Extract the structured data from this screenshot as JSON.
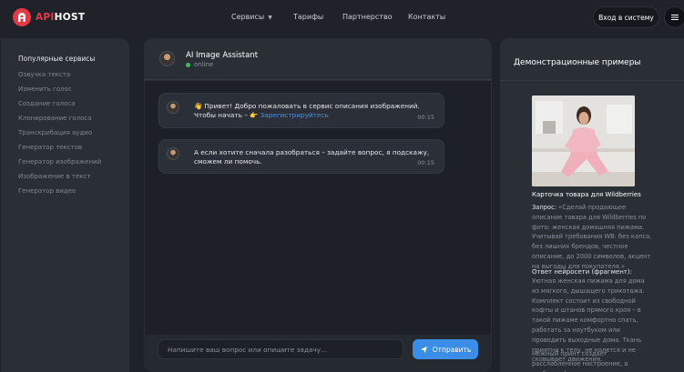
{
  "header": {
    "logo_prefix": "API",
    "logo_suffix": "HOST",
    "nav": [
      {
        "label": "Сервисы"
      },
      {
        "label": "Тарифы"
      },
      {
        "label": "Партнерство"
      },
      {
        "label": "Контакты"
      }
    ],
    "login_label": "Вход в систему"
  },
  "sidebar": {
    "title": "Популярные сервисы",
    "items": [
      {
        "label": "Озвучка текста"
      },
      {
        "label": "Изменить голос"
      },
      {
        "label": "Создание голоса"
      },
      {
        "label": "Клонирование голоса"
      },
      {
        "label": "Транскрибация аудио"
      },
      {
        "label": "Генератор текстов"
      },
      {
        "label": "Генератор изображений"
      },
      {
        "label": "Изображение в текст"
      },
      {
        "label": "Генератор видео"
      }
    ]
  },
  "chat": {
    "assistant_name": "AI Image Assistant",
    "status": "online",
    "messages": [
      {
        "line1": "👋 Привет! Добро пожаловать в сервис описания изображений.",
        "line2_prefix": "Чтобы начать – 👉 ",
        "link": "Зарегистрируйтесь",
        "time": "00:15"
      },
      {
        "line1": "А если хотите сначала разобраться – задайте вопрос, я подскажу,",
        "line2": "сможем ли помочь.",
        "time": "00:15"
      }
    ],
    "input_placeholder": "Напишите ваш вопрос или опишите задачу...",
    "send_label": "Отправить"
  },
  "demo": {
    "title": "Демонстрационные примеры",
    "caption": "Карточка товара для Wildberries",
    "request_label": "Запрос:",
    "request_text": "«Сделай продающее описание товара для Wildberries по фото: женская домашняя пижама. Учитывай требования WB: без капса, без лишних брендов, честное описание, до 2000 символов, акцент на выгоды для покупателя.»",
    "answer_label": "Ответ нейросети (фрагмент):",
    "answer_text": "Уютная женская пижама для дома из мягкого, дышащего трикотажа. Комплект состоит из свободной кофты и штанов прямого кроя – в такой пижаме комфортно спать, работать за ноутбуком или проводить выходные дома. Ткань приятна к телу, не колется и не сковывает движения.",
    "answer_text2": "Нежный принт создаёт расслабленное настроение, а свободный силуэт подходит"
  },
  "colors": {
    "accent": "#e53945",
    "primary": "#3b8ee8",
    "online": "#3dbb5e"
  }
}
